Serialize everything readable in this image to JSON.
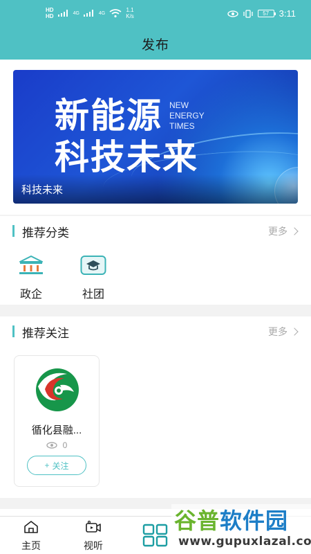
{
  "status_bar": {
    "hd1": "HD",
    "hd2": "HD",
    "net1": "4G",
    "net2": "4G",
    "speed_value": "1.1",
    "speed_unit": "K/s",
    "battery": "57",
    "time": "3:11"
  },
  "header": {
    "title": "发布"
  },
  "banner": {
    "line1": "新能源",
    "line2": "科技未来",
    "en_lines": [
      "NEW",
      "ENERGY",
      "TIMES"
    ],
    "caption": "科技未来"
  },
  "categories": {
    "title": "推荐分类",
    "more": "更多",
    "items": [
      {
        "label": "政企",
        "icon": "government-building-icon"
      },
      {
        "label": "社团",
        "icon": "graduation-cap-icon"
      }
    ]
  },
  "follow": {
    "title": "推荐关注",
    "more": "更多",
    "cards": [
      {
        "name": "循化县融...",
        "views": "0",
        "follow_label": "关注",
        "logo": "county-media-logo"
      }
    ]
  },
  "tabbar": {
    "items": [
      {
        "label": "主页",
        "icon": "home-icon"
      },
      {
        "label": "视听",
        "icon": "video-camera-icon"
      }
    ]
  },
  "watermark": {
    "chars_green": "谷普",
    "chars_blue": "软件园",
    "url": "www.gupuxlazal.com"
  },
  "colors": {
    "accent": "#4fc1c4",
    "banner_blue": "#1e56d6"
  }
}
